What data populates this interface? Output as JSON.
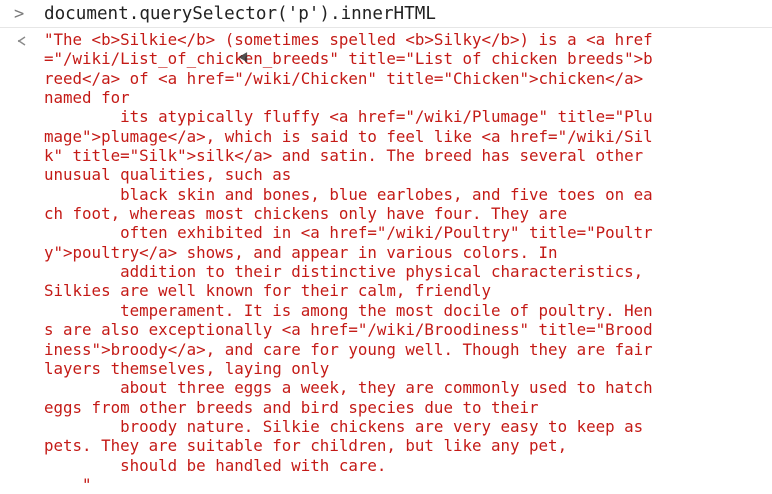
{
  "console": {
    "input": {
      "prompt": ">",
      "command": "document.querySelector('p').innerHTML"
    },
    "output": {
      "value_lines": [
        "\"The <b>Silkie</b> (sometimes spelled <b>Silky</b>) is a <a href",
        "=\"/wiki/List_of_chicken_breeds\" title=\"List of chicken breeds\">b",
        "reed</a> of <a href=\"/wiki/Chicken\" title=\"Chicken\">chicken</a>",
        "named for",
        "        its atypically fluffy <a href=\"/wiki/Plumage\" title=\"Plu",
        "mage\">plumage</a>, which is said to feel like <a href=\"/wiki/Sil",
        "k\" title=\"Silk\">silk</a> and satin. The breed has several other",
        "unusual qualities, such as",
        "        black skin and bones, blue earlobes, and five toes on ea",
        "ch foot, whereas most chickens only have four. They are",
        "        often exhibited in <a href=\"/wiki/Poultry\" title=\"Poultr",
        "y\">poultry</a> shows, and appear in various colors. In",
        "        addition to their distinctive physical characteristics,",
        "Silkies are well known for their calm, friendly",
        "        temperament. It is among the most docile of poultry. Hen",
        "s are also exceptionally <a href=\"/wiki/Broodiness\" title=\"Brood",
        "iness\">broody</a>, and care for young well. Though they are fair",
        "layers themselves, laying only",
        "        about three eggs a week, they are commonly used to hatch",
        "eggs from other breeds and bird species due to their",
        "        broody nature. Silkie chickens are very easy to keep as",
        "pets. They are suitable for children, but like any pet,",
        "        should be handled with care.",
        "    \""
      ]
    }
  },
  "colors": {
    "string_value": "#c41a16",
    "command_text": "#222222",
    "prompt_glyph": "#7a7a7a"
  },
  "icons": {
    "input_prompt": "chevron-right-icon",
    "result_marker": "return-arrow-icon"
  }
}
